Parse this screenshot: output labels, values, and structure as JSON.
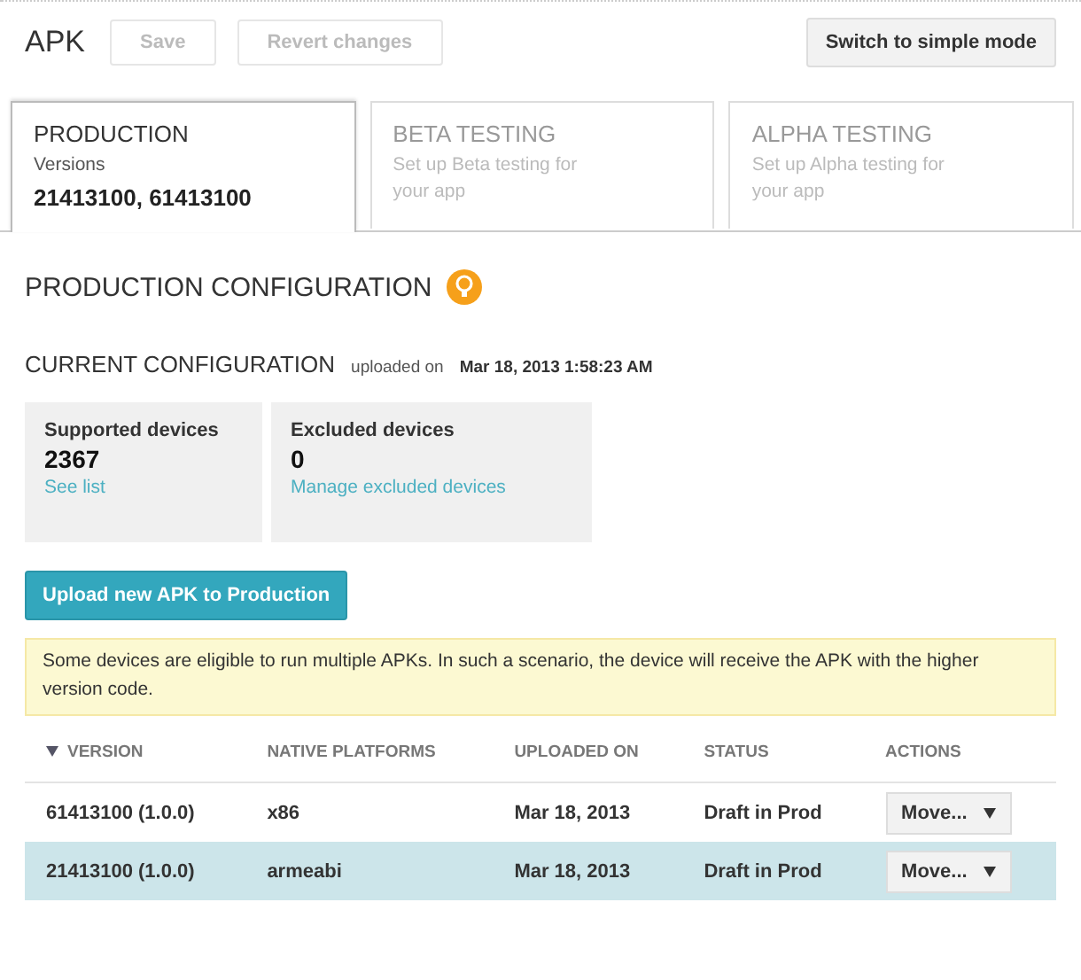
{
  "header": {
    "title": "APK",
    "buttons": [
      {
        "label": "Save",
        "disabled": true
      },
      {
        "label": "Revert changes",
        "disabled": true
      }
    ],
    "mode_button": "Switch to simple mode"
  },
  "tabs": [
    {
      "title": "PRODUCTION",
      "subtitle": "Versions",
      "detail": "21413100, 61413100",
      "selected": true
    },
    {
      "title": "BETA TESTING",
      "subtitle": "Set up Beta testing for your app",
      "selected": false
    },
    {
      "title": "ALPHA TESTING",
      "subtitle": "Set up Alpha testing for your app",
      "selected": false
    }
  ],
  "section_title": "PRODUCTION CONFIGURATION",
  "current": {
    "title": "CURRENT CONFIGURATION",
    "uploaded_prefix": "uploaded on",
    "uploaded_date": "Mar 18, 2013 1:58:23 AM"
  },
  "device_cards": [
    {
      "label": "Supported devices",
      "count": "2367",
      "link": "See list"
    },
    {
      "label": "Excluded devices",
      "count": "0",
      "link": "Manage excluded devices"
    }
  ],
  "upload_button": "Upload new APK to Production",
  "notice": "Some devices are eligible to run multiple APKs. In such a scenario, the device will receive the APK with the higher version code.",
  "table": {
    "columns": [
      {
        "label": "VERSION",
        "sorted": true
      },
      {
        "label": "NATIVE PLATFORMS",
        "sorted": false
      },
      {
        "label": "UPLOADED ON",
        "sorted": false
      },
      {
        "label": "STATUS",
        "sorted": false
      },
      {
        "label": "ACTIONS",
        "sorted": false
      }
    ],
    "rows": [
      {
        "version": "61413100 (1.0.0)",
        "platforms": "x86",
        "uploaded": "Mar 18, 2013",
        "status": "Draft in Prod",
        "action": "Move...",
        "selected": false
      },
      {
        "version": "21413100 (1.0.0)",
        "platforms": "armeabi",
        "uploaded": "Mar 18, 2013",
        "status": "Draft in Prod",
        "action": "Move...",
        "selected": true
      }
    ]
  }
}
